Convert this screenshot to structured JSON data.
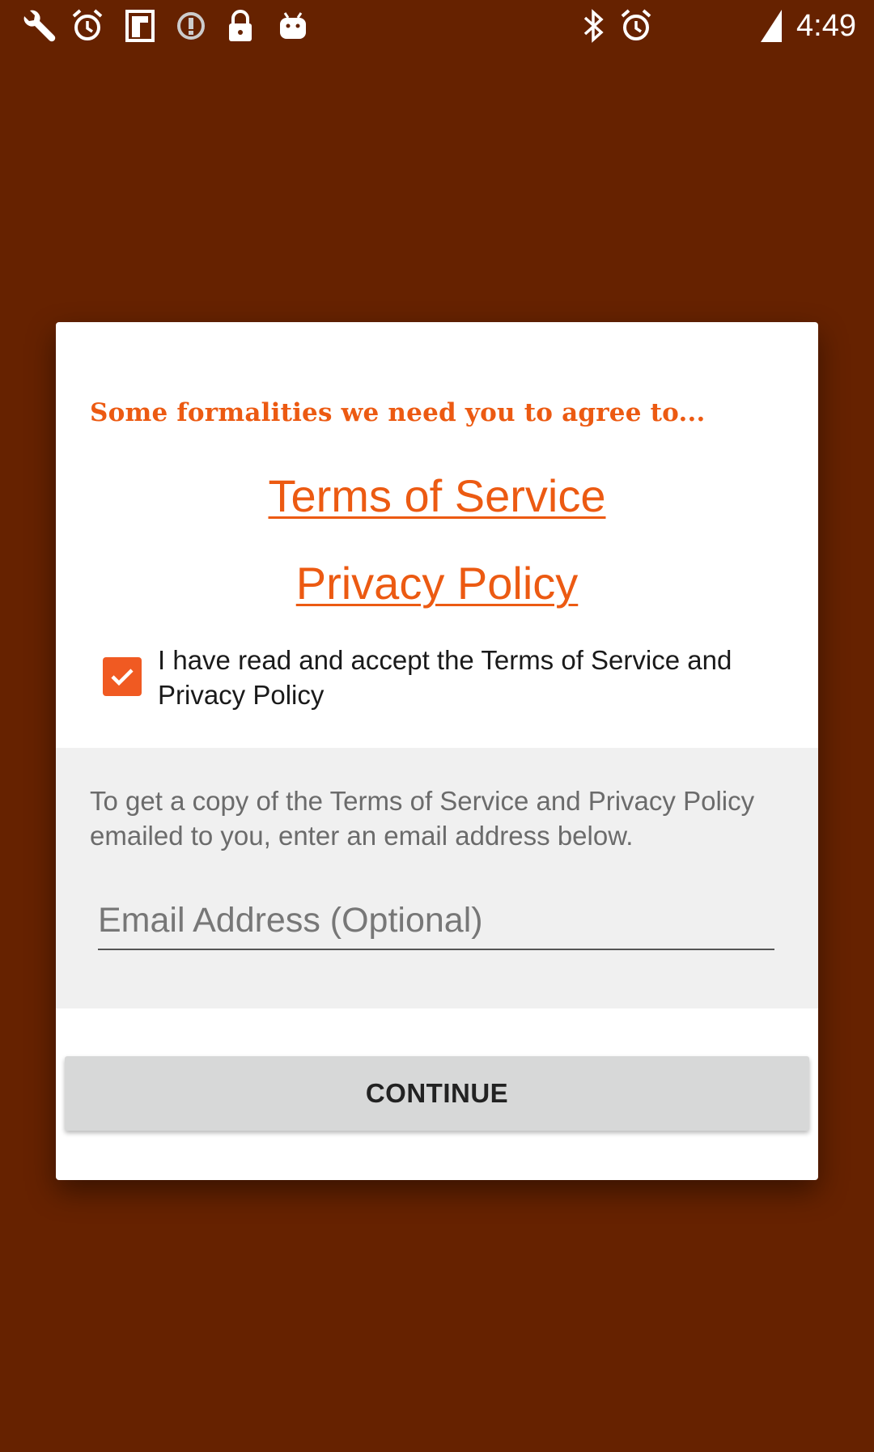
{
  "status_bar": {
    "time": "4:49",
    "left_icons": [
      "wrench-icon",
      "alarm-icon",
      "flipboard-icon",
      "info-circle-icon",
      "lock-icon",
      "android-icon"
    ],
    "right_icons": [
      "bluetooth-icon",
      "alarm-icon",
      "signal-icon"
    ]
  },
  "dialog": {
    "title": "Some formalities we need you to agree to...",
    "terms_link": "Terms of Service",
    "privacy_link": "Privacy Policy",
    "accept_checkbox": {
      "checked": true,
      "label": "I have read and accept the Terms of Service and Privacy Policy"
    },
    "email_section": {
      "help_text": "To get a copy of the Terms of Service and Privacy Policy emailed to you, enter an email address below.",
      "input_value": "",
      "input_placeholder": "Email Address (Optional)"
    },
    "continue_label": "CONTINUE"
  },
  "colors": {
    "background": "#662200",
    "accent": "#ec5a12",
    "checkbox": "#f05a22",
    "button": "#d7d8d8"
  }
}
